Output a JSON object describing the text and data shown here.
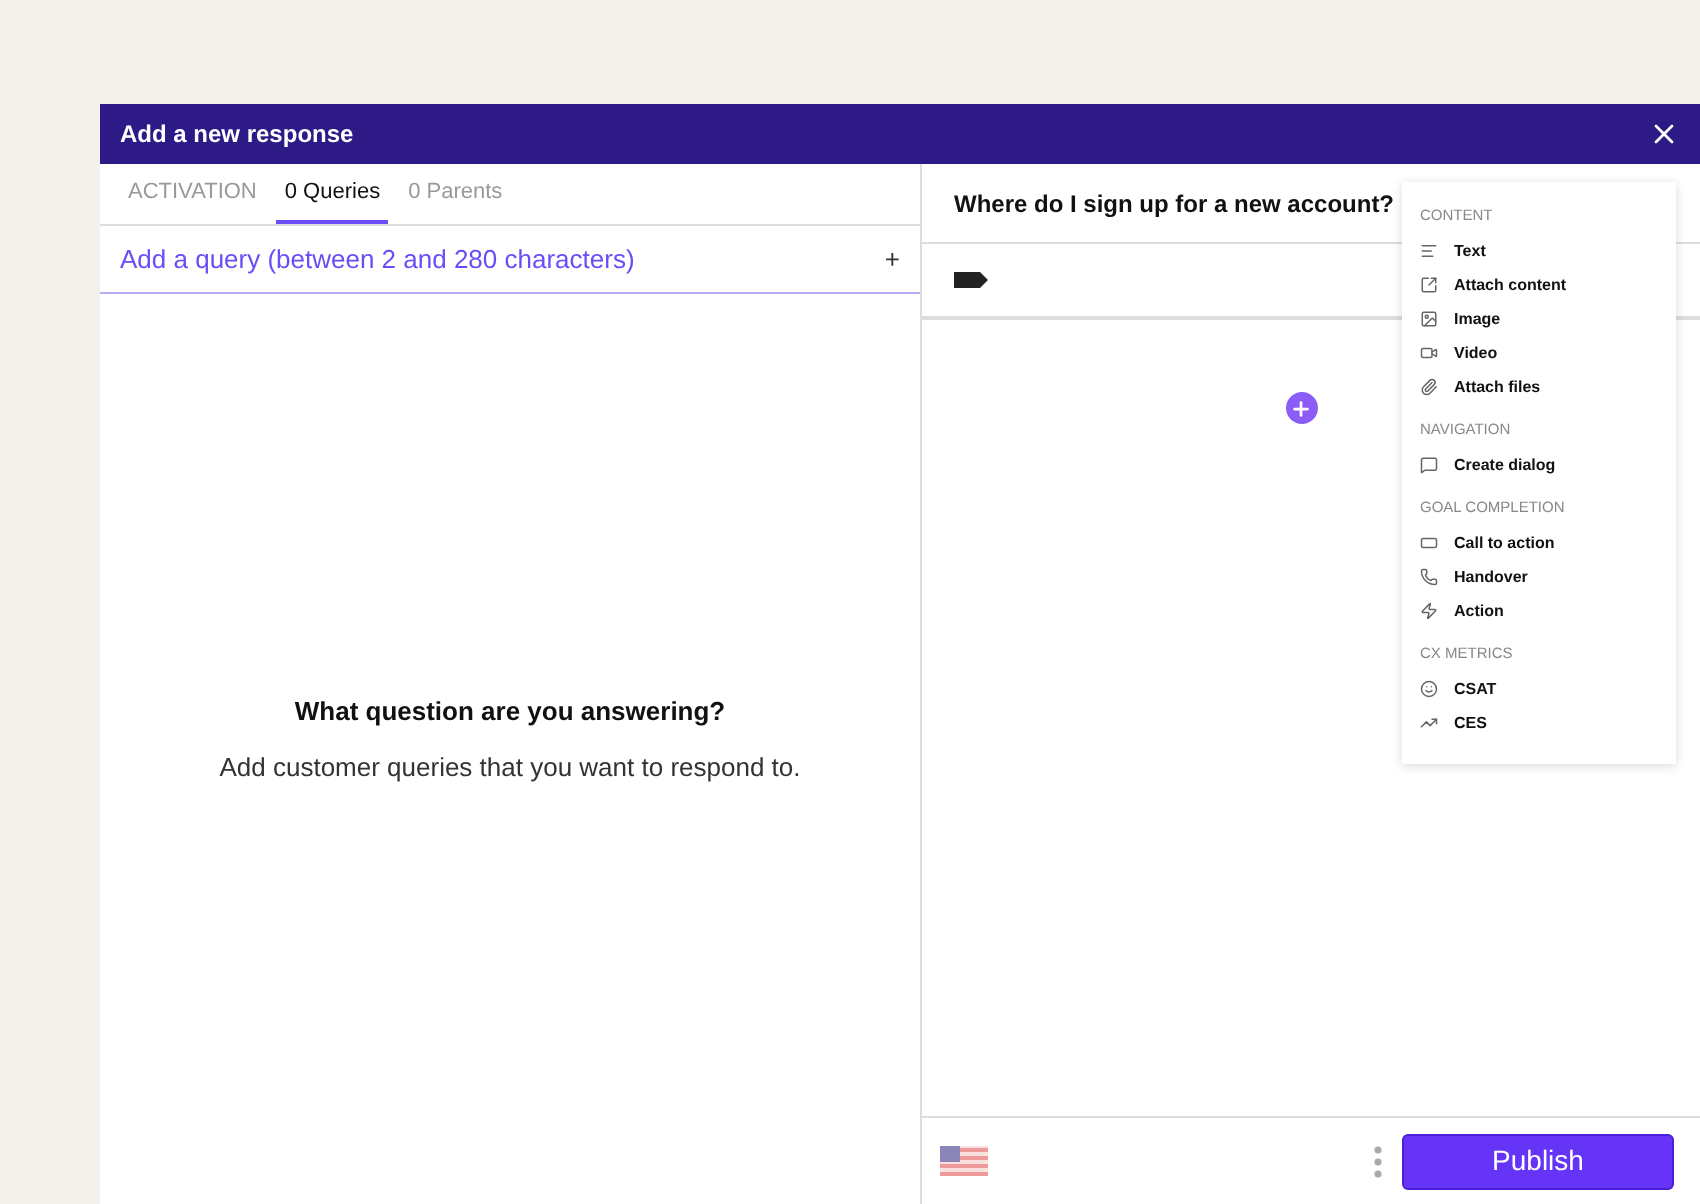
{
  "window": {
    "title": "Add a new response"
  },
  "tabs": [
    {
      "label": "ACTIVATION",
      "selected": false
    },
    {
      "label": "0 Queries",
      "selected": true
    },
    {
      "label": "0 Parents",
      "selected": false
    }
  ],
  "query_field": {
    "placeholder": "Add a query (between 2 and 280 characters)",
    "add_label": "+"
  },
  "empty_state": {
    "title": "What question are you answering?",
    "text": "Add customer queries that you want to respond to."
  },
  "response": {
    "title": "Where do I sign up for a new account?"
  },
  "menu": {
    "sections": [
      {
        "heading": "CONTENT",
        "items": [
          {
            "label": "Text",
            "kind": "text"
          },
          {
            "label": "Attach content",
            "kind": "attach"
          },
          {
            "label": "Image",
            "kind": "image"
          },
          {
            "label": "Video",
            "kind": "video"
          },
          {
            "label": "Attach files",
            "kind": "files"
          }
        ]
      },
      {
        "heading": "NAVIGATION",
        "items": [
          {
            "label": "Create dialog",
            "kind": "dialog"
          }
        ]
      },
      {
        "heading": "GOAL COMPLETION",
        "items": [
          {
            "label": "Call to action",
            "kind": "cta"
          },
          {
            "label": "Handover",
            "kind": "phone"
          },
          {
            "label": "Action",
            "kind": "action"
          }
        ]
      },
      {
        "heading": "CX METRICS",
        "items": [
          {
            "label": "CSAT",
            "kind": "csat"
          },
          {
            "label": "CES",
            "kind": "ces"
          }
        ]
      }
    ]
  },
  "footer": {
    "publish": "Publish"
  }
}
